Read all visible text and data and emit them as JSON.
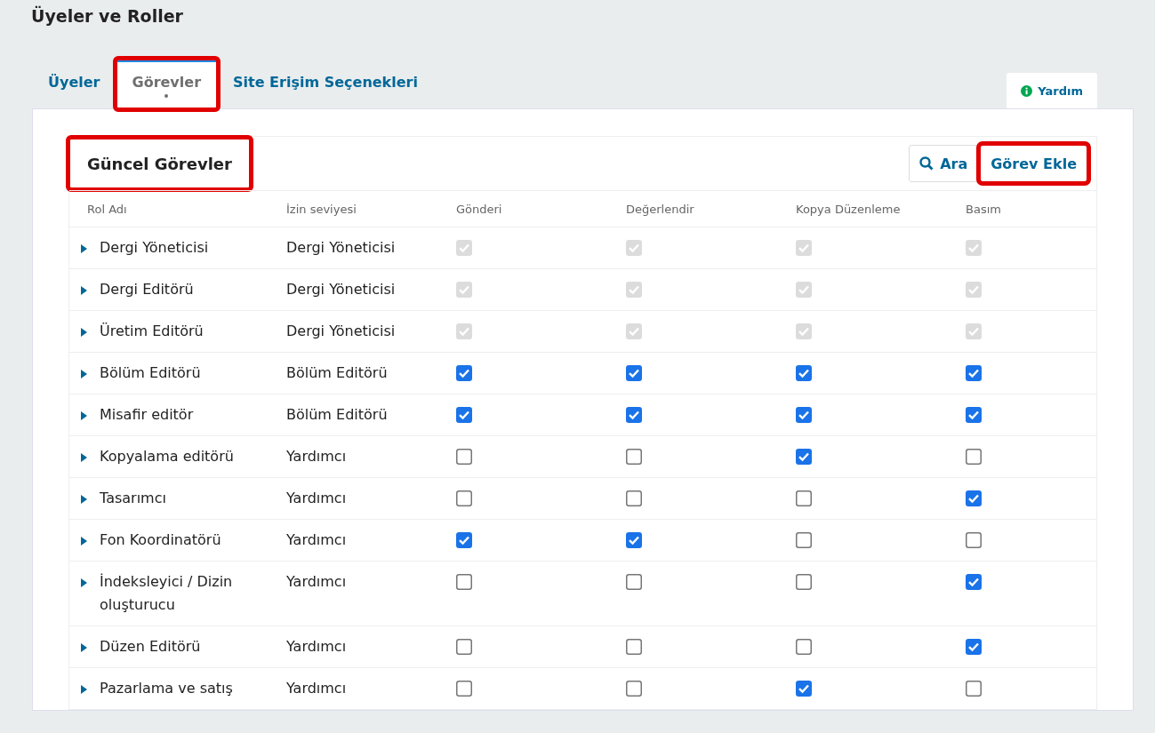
{
  "page_title": "Üyeler ve Roller",
  "tabs": [
    {
      "label": "Üyeler",
      "selected": false,
      "highlighted": false
    },
    {
      "label": "Görevler",
      "selected": true,
      "highlighted": true
    },
    {
      "label": "Site Erişim Seçenekleri",
      "selected": false,
      "highlighted": false
    }
  ],
  "help_tab": {
    "label": "Yardım"
  },
  "panel": {
    "title": "Güncel Görevler",
    "title_highlighted": true,
    "buttons": [
      {
        "kind": "search",
        "label": "Ara",
        "highlighted": false
      },
      {
        "kind": "plain",
        "label": "Görev Ekle",
        "highlighted": true
      }
    ],
    "columns": [
      "Rol Adı",
      "İzin seviyesi",
      "Gönderi",
      "Değerlendir",
      "Kopya Düzenleme",
      "Basım"
    ],
    "rows": [
      {
        "name": "Dergi Yöneticisi",
        "level": "Dergi Yöneticisi",
        "stages": [
          {
            "checked": true,
            "disabled": true
          },
          {
            "checked": true,
            "disabled": true
          },
          {
            "checked": true,
            "disabled": true
          },
          {
            "checked": true,
            "disabled": true
          }
        ]
      },
      {
        "name": "Dergi Editörü",
        "level": "Dergi Yöneticisi",
        "stages": [
          {
            "checked": true,
            "disabled": true
          },
          {
            "checked": true,
            "disabled": true
          },
          {
            "checked": true,
            "disabled": true
          },
          {
            "checked": true,
            "disabled": true
          }
        ]
      },
      {
        "name": "Üretim Editörü",
        "level": "Dergi Yöneticisi",
        "stages": [
          {
            "checked": true,
            "disabled": true
          },
          {
            "checked": true,
            "disabled": true
          },
          {
            "checked": true,
            "disabled": true
          },
          {
            "checked": true,
            "disabled": true
          }
        ]
      },
      {
        "name": "Bölüm Editörü",
        "level": "Bölüm Editörü",
        "stages": [
          {
            "checked": true,
            "disabled": false
          },
          {
            "checked": true,
            "disabled": false
          },
          {
            "checked": true,
            "disabled": false
          },
          {
            "checked": true,
            "disabled": false
          }
        ]
      },
      {
        "name": "Misafir editör",
        "level": "Bölüm Editörü",
        "stages": [
          {
            "checked": true,
            "disabled": false
          },
          {
            "checked": true,
            "disabled": false
          },
          {
            "checked": true,
            "disabled": false
          },
          {
            "checked": true,
            "disabled": false
          }
        ]
      },
      {
        "name": "Kopyalama editörü",
        "level": "Yardımcı",
        "stages": [
          {
            "checked": false,
            "disabled": false
          },
          {
            "checked": false,
            "disabled": false
          },
          {
            "checked": true,
            "disabled": false
          },
          {
            "checked": false,
            "disabled": false
          }
        ]
      },
      {
        "name": "Tasarımcı",
        "level": "Yardımcı",
        "stages": [
          {
            "checked": false,
            "disabled": false
          },
          {
            "checked": false,
            "disabled": false
          },
          {
            "checked": false,
            "disabled": false
          },
          {
            "checked": true,
            "disabled": false
          }
        ]
      },
      {
        "name": "Fon Koordinatörü",
        "level": "Yardımcı",
        "stages": [
          {
            "checked": true,
            "disabled": false
          },
          {
            "checked": true,
            "disabled": false
          },
          {
            "checked": false,
            "disabled": false
          },
          {
            "checked": false,
            "disabled": false
          }
        ]
      },
      {
        "name": "İndeksleyici / Dizin oluşturucu",
        "level": "Yardımcı",
        "stages": [
          {
            "checked": false,
            "disabled": false
          },
          {
            "checked": false,
            "disabled": false
          },
          {
            "checked": false,
            "disabled": false
          },
          {
            "checked": true,
            "disabled": false
          }
        ]
      },
      {
        "name": "Düzen Editörü",
        "level": "Yardımcı",
        "stages": [
          {
            "checked": false,
            "disabled": false
          },
          {
            "checked": false,
            "disabled": false
          },
          {
            "checked": false,
            "disabled": false
          },
          {
            "checked": true,
            "disabled": false
          }
        ]
      },
      {
        "name": "Pazarlama ve satış",
        "level": "Yardımcı",
        "stages": [
          {
            "checked": false,
            "disabled": false
          },
          {
            "checked": false,
            "disabled": false
          },
          {
            "checked": true,
            "disabled": false
          },
          {
            "checked": false,
            "disabled": false
          }
        ]
      }
    ]
  }
}
